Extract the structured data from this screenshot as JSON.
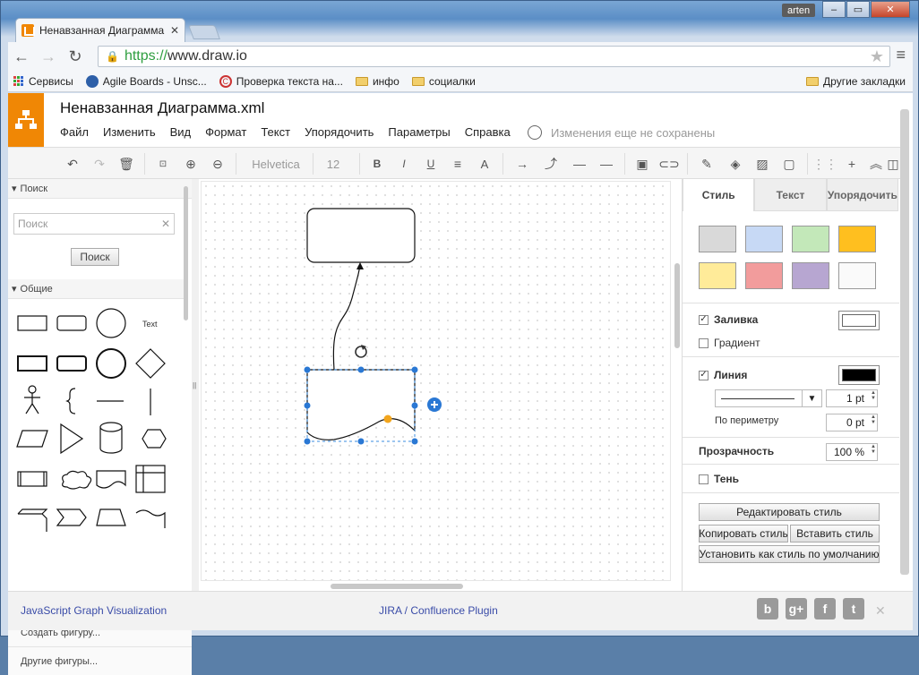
{
  "browser": {
    "tab_title": "Ненавзанная Диаграмма",
    "user": "arten",
    "url_scheme": "https://",
    "url_rest": "www.draw.io",
    "bookmarks": [
      "Сервисы",
      "Agile Boards - Unsc...",
      "Проверка текста на...",
      "инфо",
      "социалки"
    ],
    "other_bookmarks": "Другие закладки"
  },
  "app": {
    "title": "Ненавзанная Диаграмма.xml",
    "menu": [
      "Файл",
      "Изменить",
      "Вид",
      "Формат",
      "Текст",
      "Упорядочить",
      "Параметры",
      "Справка"
    ],
    "unsaved": "Изменения еще не сохранены",
    "font_name": "Helvetica",
    "font_size": "12"
  },
  "left_panel": {
    "search_section": "Поиск",
    "search_placeholder": "Поиск",
    "search_button": "Поиск",
    "general_section": "Общие",
    "shape_text": "Text",
    "create_shape": "Создать фигуру...",
    "more_shapes": "Другие фигуры..."
  },
  "right_panel": {
    "tabs": [
      "Стиль",
      "Текст",
      "Упорядочить"
    ],
    "fill": "Заливка",
    "gradient": "Градиент",
    "line": "Линия",
    "line_width": "1 pt",
    "perimeter": "По периметру",
    "perimeter_value": "0 pt",
    "opacity": "Прозрачность",
    "opacity_value": "100 %",
    "shadow": "Тень",
    "edit_style": "Редактировать стиль",
    "copy_style": "Копировать стиль",
    "paste_style": "Вставить стиль",
    "set_default": "Установить как стиль по умолчанию",
    "swatch_colors": [
      "#d9d9d9",
      "#c7d9f5",
      "#c3e8b9",
      "#ffbf1f",
      "#ffeb99",
      "#f29c9c",
      "#b7a6d1",
      "#fafafa"
    ]
  },
  "footer": {
    "left_link": "JavaScript Graph Visualization",
    "mid_link": "JIRA / Confluence Plugin",
    "social": [
      "b",
      "g+",
      "f",
      "t"
    ]
  }
}
